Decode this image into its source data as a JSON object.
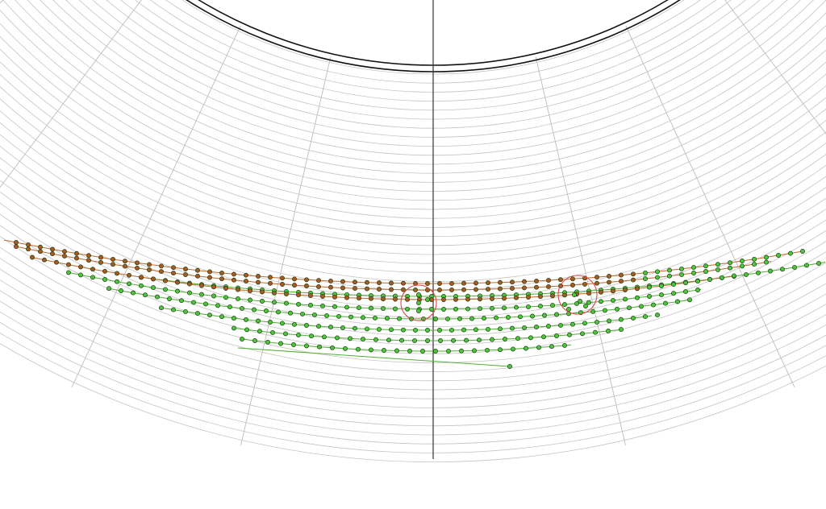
{
  "colors": {
    "background": "#ffffff",
    "grid_arc": "#c4c4c4",
    "grid_spoke": "#bdbdbd",
    "axis": "#333333",
    "double_arc": "#111111",
    "track_green": "#4fb034",
    "track_orange": "#c06a28",
    "hit_green_fill": "#49c83a",
    "hit_orange_fill": "#a85a20",
    "hit_stroke": "#1f3a14",
    "highlight_circle": "#d84a4a"
  },
  "scene": {
    "grid_arc_count": 44,
    "spoke_count": 9,
    "highlight_count": 2,
    "track_rows": 8
  }
}
